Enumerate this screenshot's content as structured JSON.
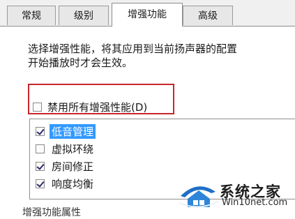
{
  "tabs": [
    {
      "label": "常规",
      "active": false
    },
    {
      "label": "级别",
      "active": false
    },
    {
      "label": "增强功能",
      "active": true
    },
    {
      "label": "高级",
      "active": false
    }
  ],
  "description": {
    "line1": "选择增强性能，将其应用到当前扬声器的配置",
    "line2": "开始播放时才会生效。"
  },
  "disable_all": {
    "label": "禁用所有增强性能(D)",
    "checked": false
  },
  "enhancements": [
    {
      "label": "低音管理",
      "checked": true,
      "selected": true
    },
    {
      "label": "虚拟环绕",
      "checked": false,
      "selected": false
    },
    {
      "label": "房间修正",
      "checked": true,
      "selected": false
    },
    {
      "label": "响度均衡",
      "checked": true,
      "selected": false
    }
  ],
  "partial_text": "增强功能属性",
  "watermark": {
    "name": "系统之家",
    "url": "Win10net.com"
  },
  "colors": {
    "highlight": "#3399ff",
    "annotation_box": "#c8262d"
  }
}
